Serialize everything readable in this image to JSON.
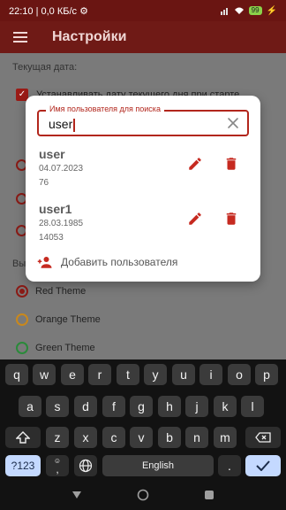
{
  "status_bar": {
    "left_text": "22:10 | 0,0 КБ/с ⚙",
    "battery": "99"
  },
  "app_bar": {
    "title": "Настройки"
  },
  "settings": {
    "current_date_label": "Текущая дата:",
    "set_date_checkbox_label": "Устанавливать дату текущего дня при старте",
    "set_date_checked": true,
    "theme_section_label": "Вы",
    "themes": [
      {
        "label": "Red Theme",
        "color": "#8a1b16",
        "selected": true
      },
      {
        "label": "Orange Theme",
        "color": "#c9881c",
        "selected": false
      },
      {
        "label": "Green Theme",
        "color": "#2a8a3a",
        "selected": false
      }
    ]
  },
  "dialog": {
    "search_label": "Имя пользователя для поиска",
    "search_value": "user",
    "users": [
      {
        "name": "user",
        "date": "04.07.2023",
        "number": "76"
      },
      {
        "name": "user1",
        "date": "28.03.1985",
        "number": "14053"
      }
    ],
    "add_user_label": "Добавить пользователя",
    "accent_color": "#b2261c"
  },
  "keyboard": {
    "row1": [
      "q",
      "w",
      "e",
      "r",
      "t",
      "y",
      "u",
      "i",
      "o",
      "p"
    ],
    "row2": [
      "a",
      "s",
      "d",
      "f",
      "g",
      "h",
      "j",
      "k",
      "l"
    ],
    "row3": [
      "z",
      "x",
      "c",
      "v",
      "b",
      "n",
      "m"
    ],
    "symbols_key": "?123",
    "comma_key": ",",
    "space_label": "English",
    "period_key": "."
  }
}
